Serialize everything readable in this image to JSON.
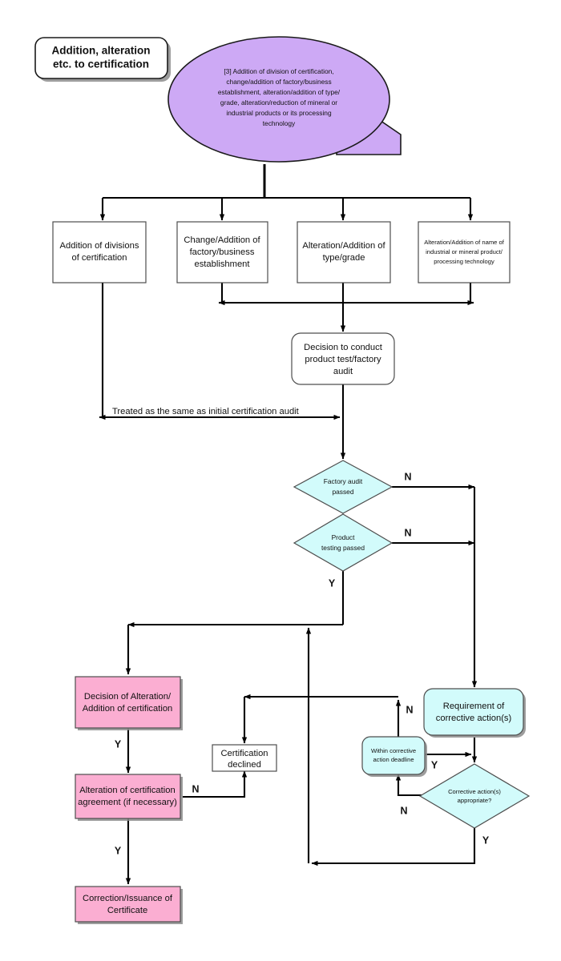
{
  "diagram": {
    "title_box": {
      "text_lines": [
        "Addition, alteration",
        "etc. to certification"
      ]
    },
    "source_bubble": {
      "text_lines": [
        "[3] Addition of division of certification,",
        "change/addition of factory/business",
        "establishment, alteration/addition of type/",
        "grade, alteration/reduction of mineral or",
        "industrial products or its processing",
        "technology"
      ]
    },
    "branch_boxes": [
      {
        "id": "addition-of-divisions",
        "text_lines": [
          "Addition of divisions",
          "of certification"
        ]
      },
      {
        "id": "change-addition-factory",
        "text_lines": [
          "Change/Addition of",
          "factory/business",
          "establishment"
        ]
      },
      {
        "id": "alteration-addition-type",
        "text_lines": [
          "Alteration/Addition of",
          "type/grade"
        ]
      },
      {
        "id": "alteration-addition-name",
        "text_lines": [
          "Alteration/Addition of name of",
          "industrial or mineral product/",
          "processing technology"
        ]
      }
    ],
    "decision_to_conduct": {
      "text_lines": [
        "Decision to conduct",
        "product test/factory",
        "audit"
      ]
    },
    "note_treated_same": "Treated as the same as initial certification audit",
    "decision_factory_audit": {
      "text_lines": [
        "Factory audit",
        "passed"
      ]
    },
    "decision_product_testing": {
      "text_lines": [
        "Product",
        "testing passed"
      ]
    },
    "requirement_corrective": {
      "text_lines": [
        "Requirement of",
        "corrective action(s)"
      ]
    },
    "within_deadline": {
      "text_lines": [
        "Within corrective",
        "action deadline"
      ]
    },
    "corrective_appropriate": {
      "text_lines": [
        "Corrective action(s)",
        "appropriate?"
      ]
    },
    "decision_alteration": {
      "text_lines": [
        "Decision of Alteration/",
        "Addition of certification"
      ]
    },
    "alteration_agreement": {
      "text_lines": [
        "Alteration of certification",
        "agreement (if necessary)"
      ]
    },
    "certification_declined": {
      "text_lines": [
        "Certification",
        "declined"
      ]
    },
    "correction_issuance": {
      "text_lines": [
        "Correction/Issuance of",
        "Certificate"
      ]
    },
    "edge_labels": {
      "factory_audit_no": "N",
      "product_testing_no": "N",
      "product_testing_yes": "Y",
      "decision_alteration_yes": "Y",
      "alteration_agreement_no": "N",
      "alteration_agreement_yes": "Y",
      "within_deadline_no": "N",
      "within_deadline_yes": "Y",
      "corrective_appropriate_no": "N",
      "corrective_appropriate_yes": "Y"
    },
    "colors": {
      "purple": "#CDA9F5",
      "pink": "#FBAED2",
      "cyan": "#D2FBFB",
      "white": "#FFFFFF",
      "line": "#000000",
      "shadow": "#8C8C8C"
    }
  }
}
